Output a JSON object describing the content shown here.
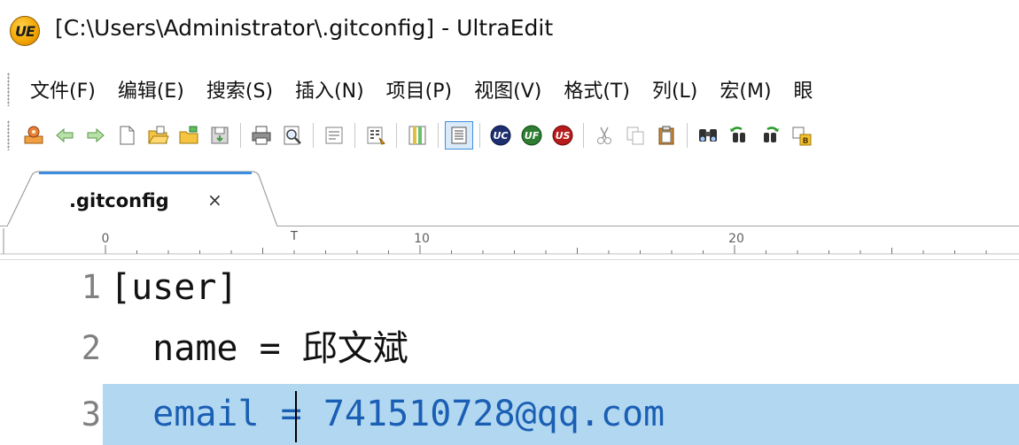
{
  "window": {
    "title": "[C:\\Users\\Administrator\\.gitconfig] - UltraEdit",
    "app_icon": "ultraedit-logo-icon",
    "app_icon_glyph": "UE"
  },
  "menu": {
    "items": [
      {
        "label": "文件(F)"
      },
      {
        "label": "编辑(E)"
      },
      {
        "label": "搜索(S)"
      },
      {
        "label": "插入(N)"
      },
      {
        "label": "项目(P)"
      },
      {
        "label": "视图(V)"
      },
      {
        "label": "格式(T)"
      },
      {
        "label": "列(L)"
      },
      {
        "label": "宏(M)"
      },
      {
        "label": "眼"
      }
    ]
  },
  "toolbar": {
    "icons": [
      "ftp-browser-icon",
      "back-icon",
      "forward-icon",
      "new-file-icon",
      "open-file-icon",
      "open-folder-icon",
      "save-icon",
      "print-icon",
      "print-preview-icon",
      "wrap-icon",
      "hex-icon",
      "column-mode-icon",
      "active-view-icon",
      "uc-icon",
      "uf-icon",
      "us-icon",
      "cut-icon",
      "copy-icon",
      "paste-icon",
      "find-icon",
      "find-prev-icon",
      "find-next-icon",
      "replace-icon"
    ],
    "selected_icon": "active-view-icon"
  },
  "tabs": [
    {
      "label": ".gitconfig",
      "close_glyph": "×"
    }
  ],
  "ruler": {
    "marks": [
      "0",
      "10",
      "20"
    ]
  },
  "editor": {
    "lines": [
      {
        "number": "1",
        "text": "[user]"
      },
      {
        "number": "2",
        "text": "  name = 邱文斌"
      },
      {
        "number": "3",
        "text": "  email = 741510728@qq.com"
      }
    ],
    "active_line": 3,
    "colors": {
      "highlight": "#b2d7f1",
      "keyword": "#1a5fb4",
      "line_number": "#808080"
    }
  }
}
